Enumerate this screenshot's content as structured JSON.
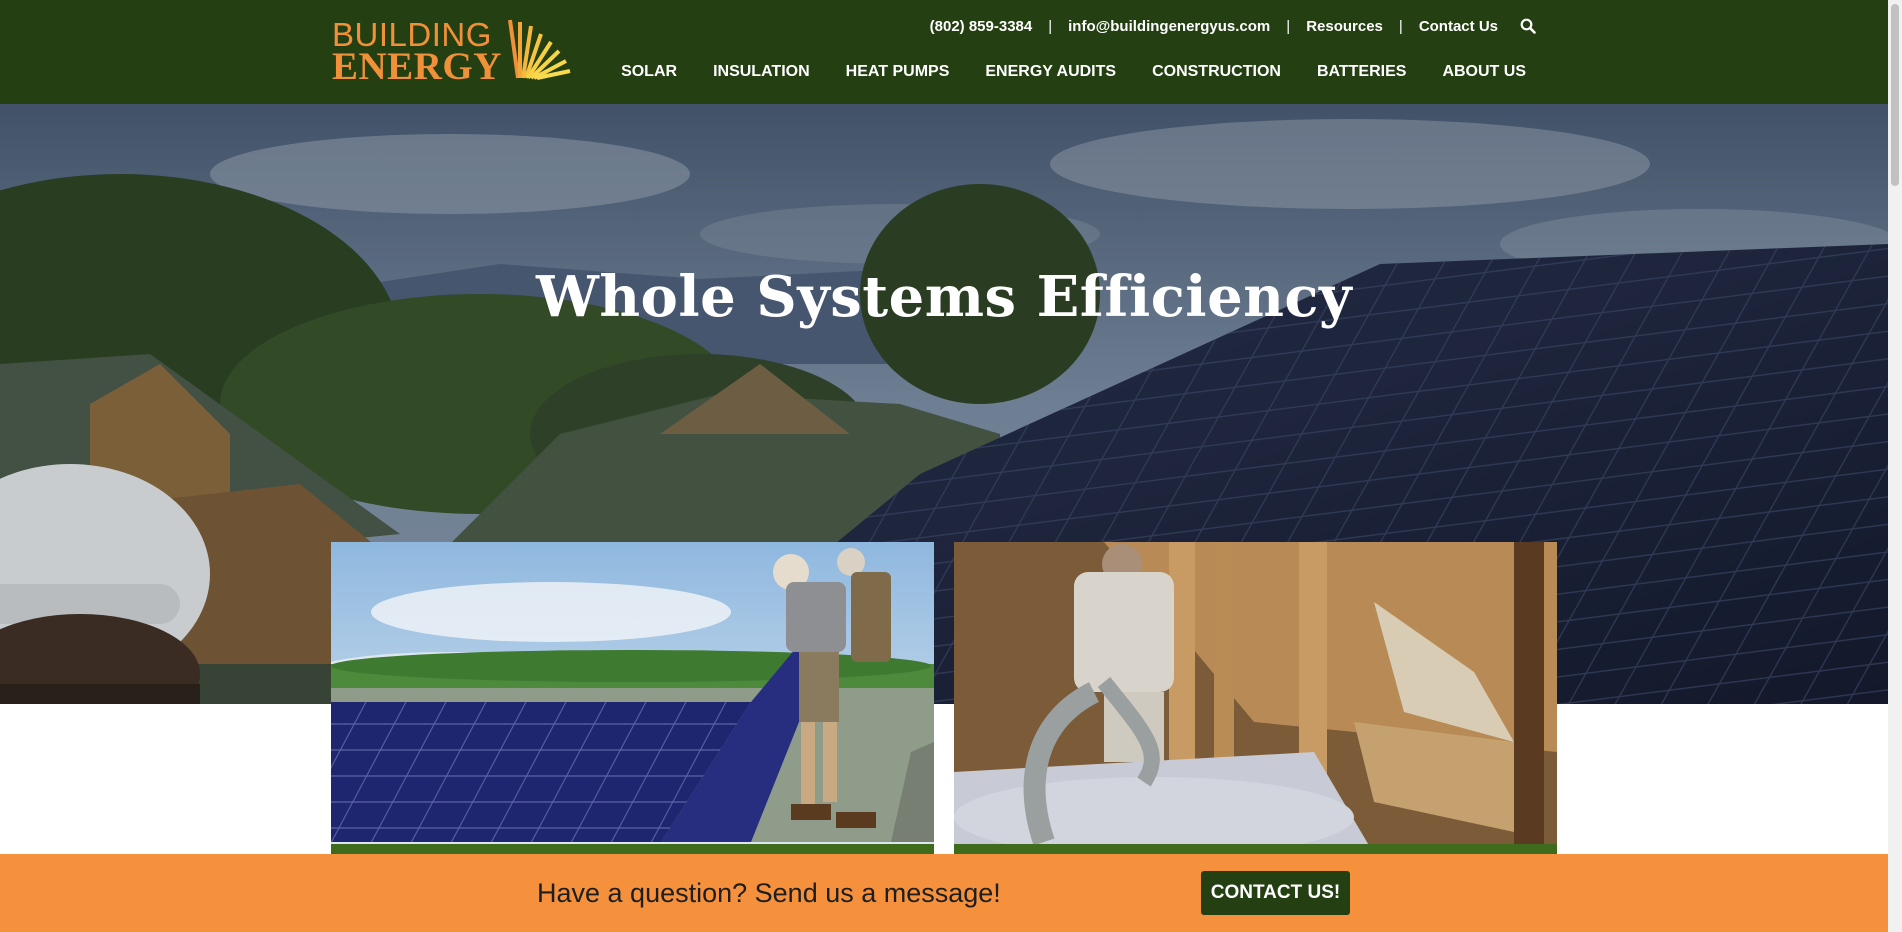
{
  "logo": {
    "line1": "BUILDING",
    "line2": "ENERGY"
  },
  "utility": {
    "phone": "(802) 859-3384",
    "email": "info@buildingenergyus.com",
    "resources": "Resources",
    "contact": "Contact Us",
    "separator": "|",
    "search_icon": "search-icon"
  },
  "nav": {
    "items": [
      "SOLAR",
      "INSULATION",
      "HEAT PUMPS",
      "ENERGY AUDITS",
      "CONSTRUCTION",
      "BATTERIES",
      "ABOUT US"
    ]
  },
  "hero": {
    "title": "Whole Systems Efficiency"
  },
  "cta": {
    "message": "Have a question? Send us a message!",
    "button": "CONTACT US!"
  },
  "colors": {
    "header": "#243f12",
    "accent": "#f5913d",
    "card_bar": "#3f6b1d",
    "logo": "#f0913a"
  }
}
